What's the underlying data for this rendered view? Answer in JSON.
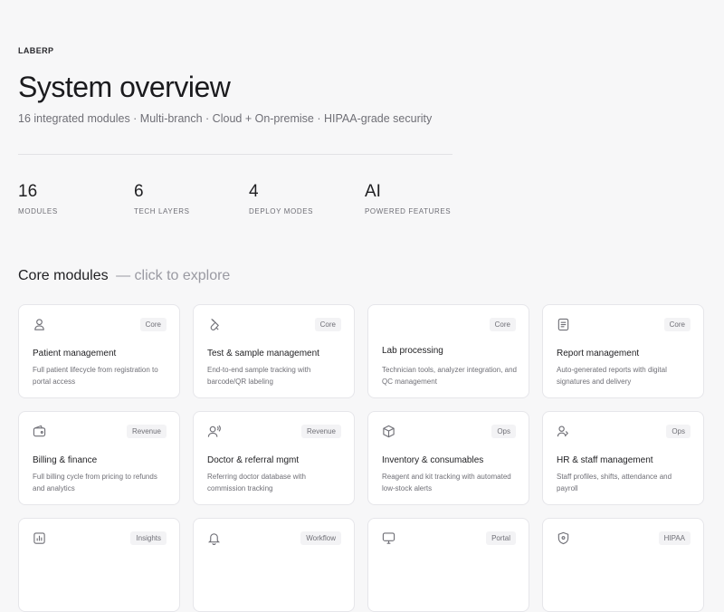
{
  "brand": "LABERP",
  "title": "System overview",
  "subtitle": "16 integrated modules · Multi-branch · Cloud + On-premise · HIPAA-grade security",
  "stats": [
    {
      "value": "16",
      "label": "MODULES"
    },
    {
      "value": "6",
      "label": "TECH LAYERS"
    },
    {
      "value": "4",
      "label": "DEPLOY MODES"
    },
    {
      "value": "AI",
      "label": "POWERED FEATURES"
    }
  ],
  "section": {
    "title": "Core modules",
    "hint": "— click to explore"
  },
  "modules": [
    {
      "icon": "user-icon",
      "badge": "Core",
      "title": "Patient management",
      "desc": "Full patient lifecycle from registration to portal access"
    },
    {
      "icon": "test-tube-icon",
      "badge": "Core",
      "title": "Test & sample management",
      "desc": "End-to-end sample tracking with barcode/QR labeling"
    },
    {
      "icon": "",
      "badge": "Core",
      "title": "Lab processing",
      "desc": "Technician tools, analyzer integration, and QC management"
    },
    {
      "icon": "report-icon",
      "badge": "Core",
      "title": "Report management",
      "desc": "Auto-generated reports with digital signatures and delivery"
    },
    {
      "icon": "wallet-icon",
      "badge": "Revenue",
      "title": "Billing & finance",
      "desc": "Full billing cycle from pricing to refunds and analytics"
    },
    {
      "icon": "doctor-icon",
      "badge": "Revenue",
      "title": "Doctor & referral mgmt",
      "desc": "Referring doctor database with commission tracking"
    },
    {
      "icon": "package-icon",
      "badge": "Ops",
      "title": "Inventory & consumables",
      "desc": "Reagent and kit tracking with automated low-stock alerts"
    },
    {
      "icon": "users-icon",
      "badge": "Ops",
      "title": "HR & staff management",
      "desc": "Staff profiles, shifts, attendance and payroll"
    },
    {
      "icon": "bar-chart-icon",
      "badge": "Insights",
      "title": "",
      "desc": ""
    },
    {
      "icon": "bell-icon",
      "badge": "Workflow",
      "title": "",
      "desc": ""
    },
    {
      "icon": "monitor-icon",
      "badge": "Portal",
      "title": "",
      "desc": ""
    },
    {
      "icon": "shield-icon",
      "badge": "HIPAA",
      "title": "",
      "desc": ""
    }
  ]
}
